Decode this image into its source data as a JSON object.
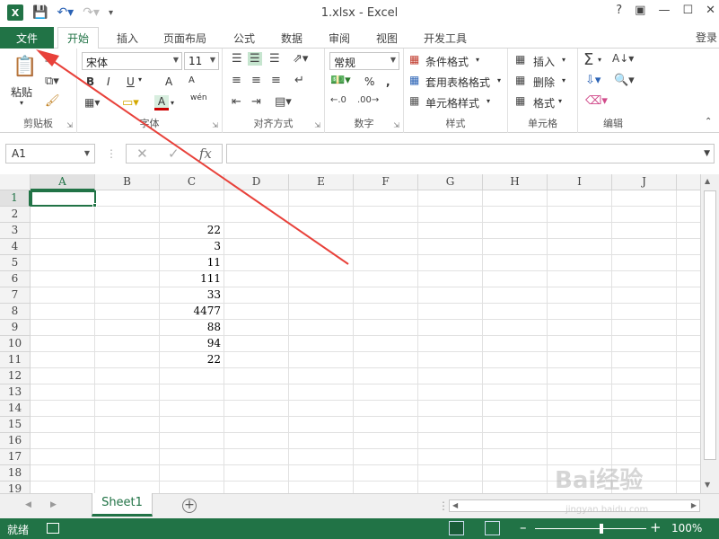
{
  "window": {
    "title": "1.xlsx - Excel",
    "app_icon": "X",
    "help": "?",
    "login": "登录"
  },
  "ribbon_tabs": [
    "文件",
    "开始",
    "插入",
    "页面布局",
    "公式",
    "数据",
    "审阅",
    "视图",
    "开发工具"
  ],
  "active_tab": "开始",
  "ribbon": {
    "clipboard": {
      "label": "剪贴板",
      "paste": "粘贴"
    },
    "font": {
      "label": "字体",
      "font_name": "宋体",
      "font_size": "11",
      "bold": "B",
      "italic": "I",
      "underline": "U",
      "grow": "A",
      "shrink": "A",
      "font_color_glyph": "A",
      "phonetic": "wén"
    },
    "alignment": {
      "label": "对齐方式"
    },
    "number": {
      "label": "数字",
      "format": "常规",
      "percent": "%",
      "comma": ","
    },
    "styles": {
      "label": "样式",
      "cond_format": "条件格式",
      "table_format": "套用表格格式",
      "cell_styles": "单元格样式"
    },
    "cells": {
      "label": "单元格",
      "insert": "插入",
      "delete": "删除",
      "format": "格式"
    },
    "editing": {
      "label": "编辑"
    }
  },
  "formula_bar": {
    "name_box": "A1",
    "fx": "fx",
    "value": ""
  },
  "sheet": {
    "columns": [
      "A",
      "B",
      "C",
      "D",
      "E",
      "F",
      "G",
      "H",
      "I",
      "J"
    ],
    "rows": [
      "1",
      "2",
      "3",
      "4",
      "5",
      "6",
      "7",
      "8",
      "9",
      "10",
      "11",
      "12",
      "13",
      "14",
      "15",
      "16",
      "17",
      "18",
      "19"
    ],
    "selected_cell": "A1",
    "column_C_values": {
      "3": "22",
      "4": "3",
      "5": "11",
      "6": "111",
      "7": "33",
      "8": "4477",
      "9": "88",
      "10": "94",
      "11": "22"
    }
  },
  "sheet_tabs": [
    "Sheet1"
  ],
  "status": {
    "ready": "就绪",
    "zoom": "100%"
  },
  "annotation": {
    "color": "#e8413a"
  },
  "watermark": {
    "text": "Bai经验",
    "sub": "jingyan.baidu.com"
  },
  "colors": {
    "excel_green": "#217346"
  }
}
